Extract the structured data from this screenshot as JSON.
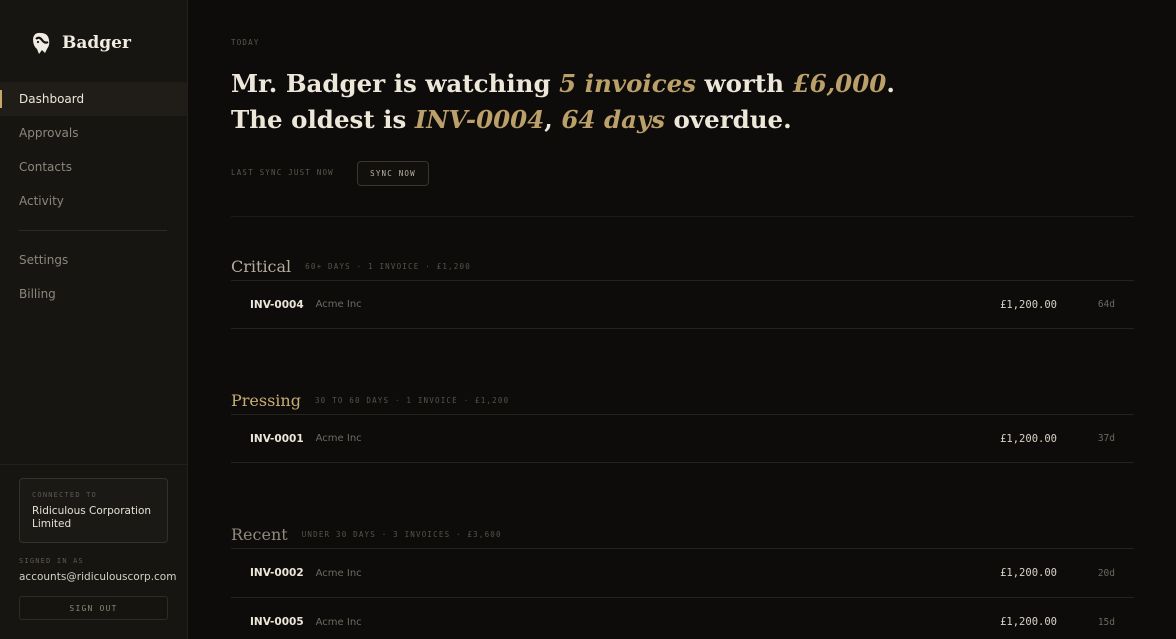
{
  "brand": {
    "name": "Badger",
    "logo_icon": "badger-logo-icon"
  },
  "nav": {
    "items": [
      {
        "label": "Dashboard",
        "active": true
      },
      {
        "label": "Approvals",
        "active": false
      },
      {
        "label": "Contacts",
        "active": false
      },
      {
        "label": "Activity",
        "active": false
      }
    ],
    "secondary": [
      {
        "label": "Settings"
      },
      {
        "label": "Billing"
      }
    ]
  },
  "account": {
    "connected_label": "Connected to",
    "organisation": "Ridiculous Corporation Limited",
    "signed_in_label": "Signed in as",
    "email": "accounts@ridiculouscorp.com",
    "sign_out": "Sign out"
  },
  "header": {
    "today_label": "Today",
    "headline": {
      "p1": "Mr. Badger is watching ",
      "count": "5 invoices",
      "p2": " worth ",
      "total": "£6,000",
      "p3": ". The oldest is ",
      "oldest": "INV-0004",
      "p4": ", ",
      "overdue": "64 days",
      "p5": " overdue."
    },
    "sync_status": "Last sync just now",
    "sync_button": "Sync now"
  },
  "groups": [
    {
      "title": "Critical",
      "meta": "60+ days · 1 invoice · £1,200",
      "color": "#b3ab9c",
      "invoices": [
        {
          "id": "INV-0004",
          "client": "Acme Inc",
          "amount": "£1,200.00",
          "age": "64d"
        }
      ]
    },
    {
      "title": "Pressing",
      "meta": "30 to 60 days · 1 invoice · £1,200",
      "color": "#c7ad76",
      "invoices": [
        {
          "id": "INV-0001",
          "client": "Acme Inc",
          "amount": "£1,200.00",
          "age": "37d"
        }
      ]
    },
    {
      "title": "Recent",
      "meta": "Under 30 days · 3 invoices · £3,600",
      "color": "#918a7d",
      "invoices": [
        {
          "id": "INV-0002",
          "client": "Acme Inc",
          "amount": "£1,200.00",
          "age": "20d"
        },
        {
          "id": "INV-0005",
          "client": "Acme Inc",
          "amount": "£1,200.00",
          "age": "15d"
        }
      ]
    }
  ],
  "colors": {
    "accent": "#c6a769",
    "background": "#0d0c0a",
    "sidebar": "#171512"
  }
}
